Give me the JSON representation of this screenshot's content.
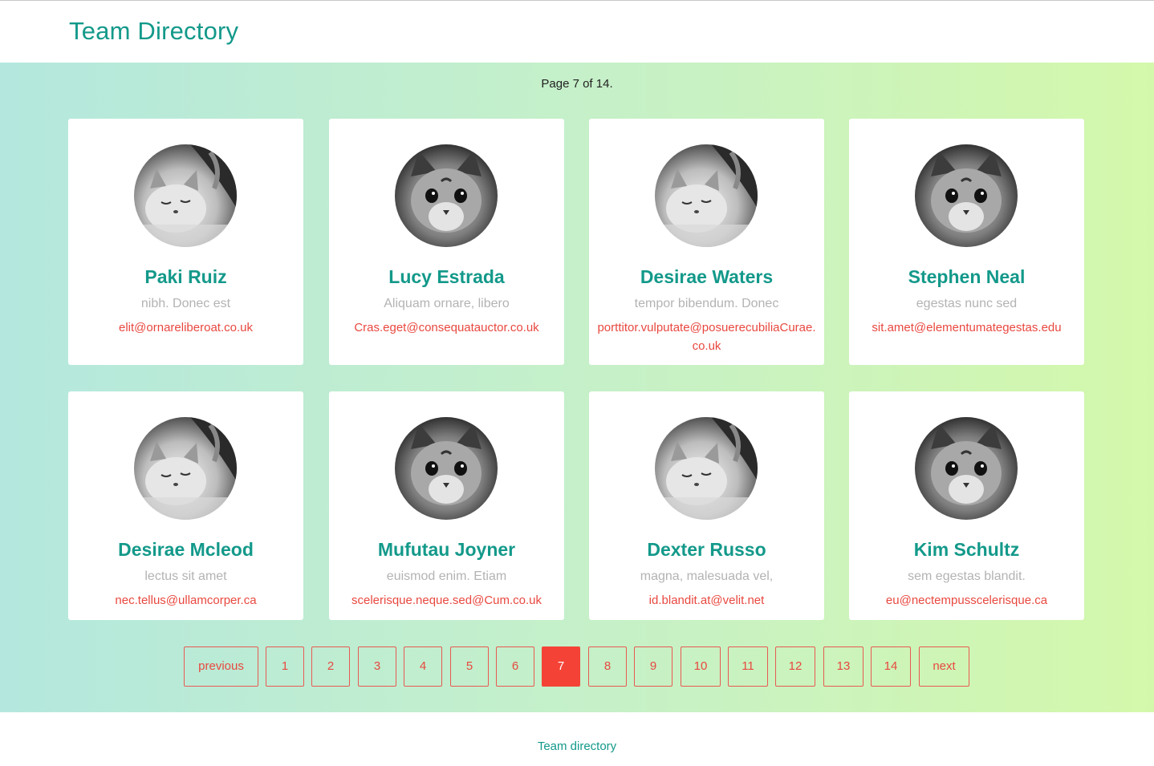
{
  "header": {
    "title": "Team Directory"
  },
  "page_info": "Page 7 of 14.",
  "members": [
    {
      "name": "Paki Ruiz",
      "role": "nibh. Donec est",
      "email": "elit@ornareliberoat.co.uk",
      "avatar": "sleeping-kitten-photo"
    },
    {
      "name": "Lucy Estrada",
      "role": "Aliquam ornare, libero",
      "email": "Cras.eget@consequatauctor.co.uk",
      "avatar": "kitten-face-photo"
    },
    {
      "name": "Desirae Waters",
      "role": "tempor bibendum. Donec",
      "email": "porttitor.vulputate@posuerecubiliaCurae.co.uk",
      "avatar": "sleeping-kitten-photo"
    },
    {
      "name": "Stephen Neal",
      "role": "egestas nunc sed",
      "email": "sit.amet@elementumategestas.edu",
      "avatar": "kitten-face-photo"
    },
    {
      "name": "Desirae Mcleod",
      "role": "lectus sit amet",
      "email": "nec.tellus@ullamcorper.ca",
      "avatar": "sleeping-kitten-photo"
    },
    {
      "name": "Mufutau Joyner",
      "role": "euismod enim. Etiam",
      "email": "scelerisque.neque.sed@Cum.co.uk",
      "avatar": "kitten-face-photo"
    },
    {
      "name": "Dexter Russo",
      "role": "magna, malesuada vel,",
      "email": "id.blandit.at@velit.net",
      "avatar": "sleeping-kitten-photo"
    },
    {
      "name": "Kim Schultz",
      "role": "sem egestas blandit.",
      "email": "eu@nectempusscelerisque.ca",
      "avatar": "kitten-face-photo"
    }
  ],
  "pagination": {
    "items": [
      "previous",
      "1",
      "2",
      "3",
      "4",
      "5",
      "6",
      "7",
      "8",
      "9",
      "10",
      "11",
      "12",
      "13",
      "14",
      "next"
    ],
    "current": "7"
  },
  "footer": {
    "link": "Team directory"
  },
  "colors": {
    "accent": "#13998a",
    "link": "#e8483f",
    "active": "#f44336"
  }
}
